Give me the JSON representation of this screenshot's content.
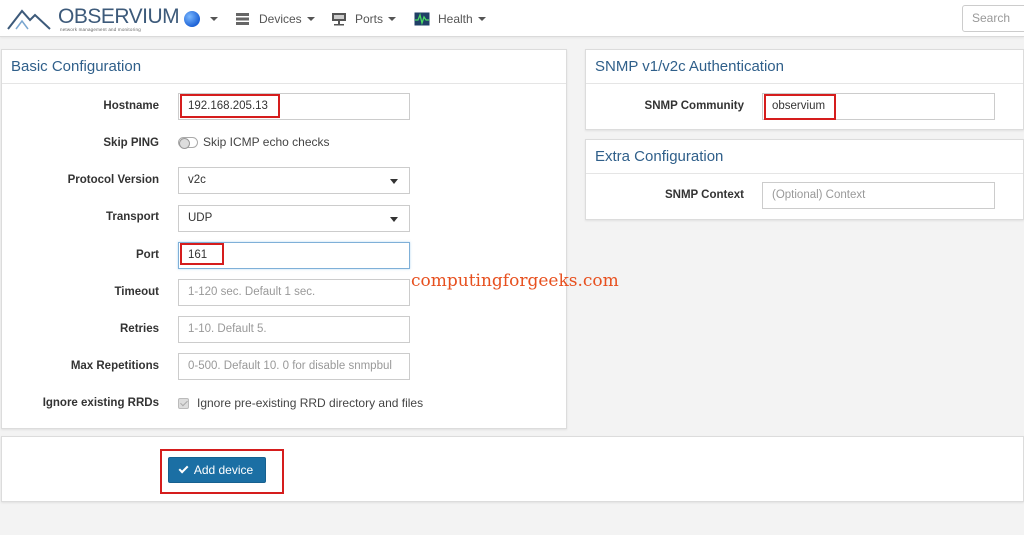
{
  "navbar": {
    "logo_text": "OBSERVIUM",
    "logo_subtitle": "network management and monitoring",
    "devices_label": "Devices",
    "ports_label": "Ports",
    "health_label": "Health",
    "search_placeholder": "Search"
  },
  "basic": {
    "title": "Basic Configuration",
    "hostname_label": "Hostname",
    "hostname_value": "192.168.205.13",
    "skip_ping_label": "Skip PING",
    "skip_ping_text": "Skip ICMP echo checks",
    "protocol_label": "Protocol Version",
    "protocol_value": "v2c",
    "transport_label": "Transport",
    "transport_value": "UDP",
    "port_label": "Port",
    "port_value": "161",
    "timeout_label": "Timeout",
    "timeout_placeholder": "1-120 sec. Default 1 sec.",
    "retries_label": "Retries",
    "retries_placeholder": "1-10. Default 5.",
    "maxrep_label": "Max Repetitions",
    "maxrep_placeholder": "0-500. Default 10. 0 for disable snmpbul",
    "ignore_label": "Ignore existing RRDs",
    "ignore_text": "Ignore pre-existing RRD directory and files"
  },
  "snmp": {
    "title": "SNMP v1/v2c Authentication",
    "community_label": "SNMP Community",
    "community_value": "observium"
  },
  "extra": {
    "title": "Extra Configuration",
    "context_label": "SNMP Context",
    "context_placeholder": "(Optional) Context"
  },
  "watermark": "computingforgeeks.com",
  "actions": {
    "add_label": "Add device"
  },
  "colors": {
    "accent": "#1b6fa4",
    "heading": "#2f5f8a",
    "highlight": "#d51d1d",
    "watermark": "#e7501f"
  }
}
